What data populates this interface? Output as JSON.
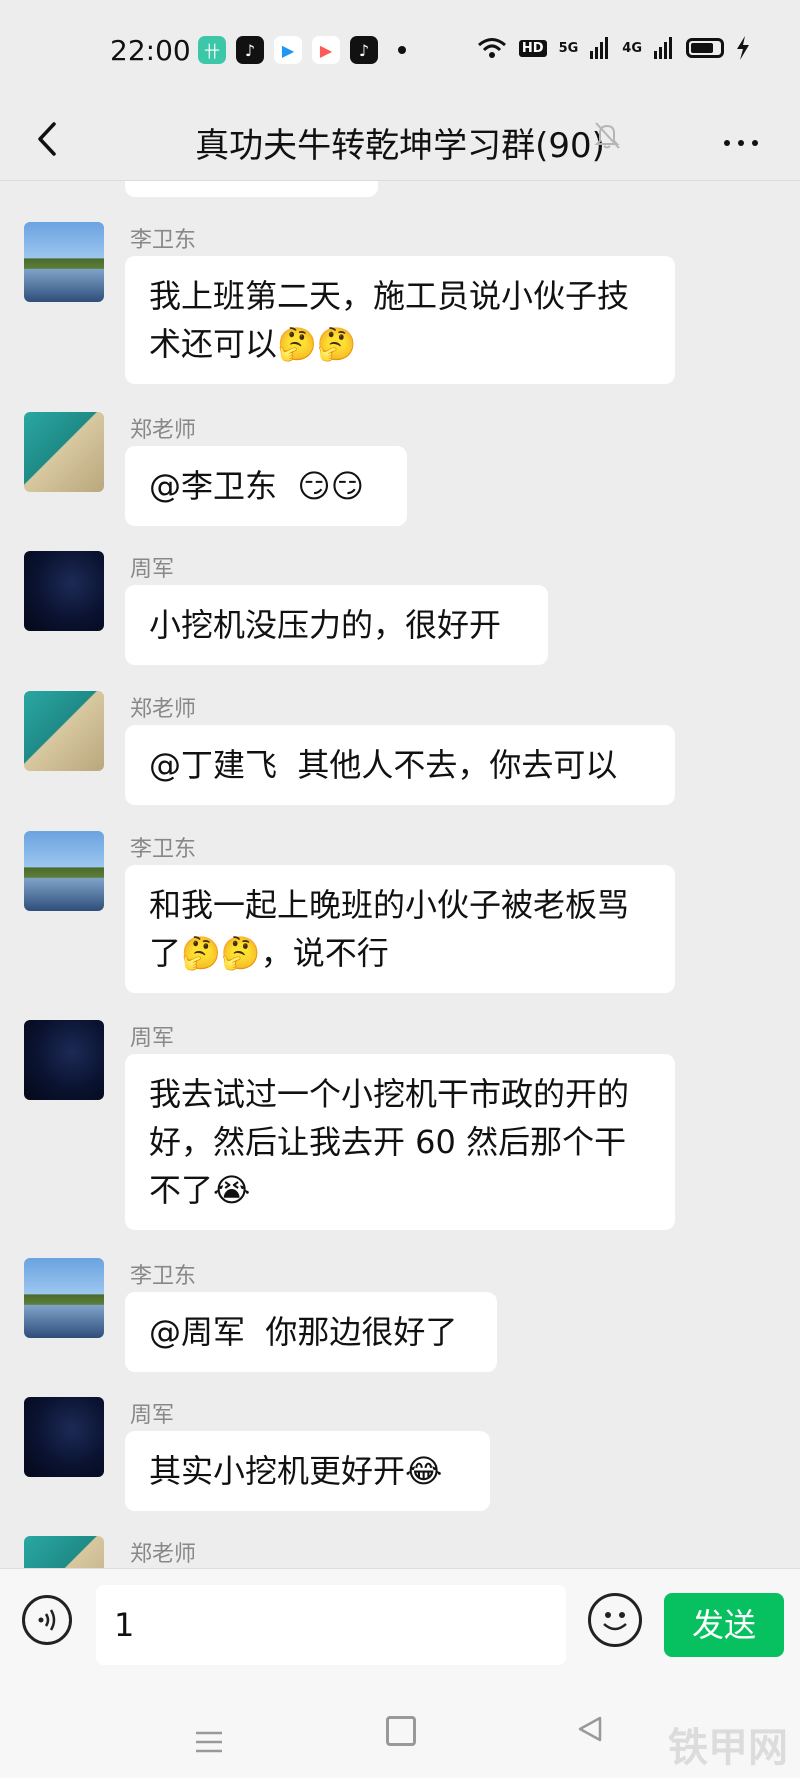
{
  "status_bar": {
    "time": "22:00",
    "app_icons": [
      "卄",
      "♪",
      "▶",
      "▶",
      "♪"
    ],
    "network_hd": "HD",
    "network_5g": "5G",
    "network_4g": "4G"
  },
  "header": {
    "title": "真功夫牛转乾坤学习群(90)",
    "back_icon": "chevron-left-icon",
    "mute_icon": "bell-off-icon",
    "more_icon": "more-icon"
  },
  "messages": [
    {
      "sender": "李卫东",
      "avatar": "lake",
      "text": "我上班第二天，施工员说小伙子技术还可以🤔🤔"
    },
    {
      "sender": "郑老师",
      "avatar": "forklift",
      "text": "@李卫东  😏😏"
    },
    {
      "sender": "周军",
      "avatar": "night",
      "text": "小挖机没压力的，很好开"
    },
    {
      "sender": "郑老师",
      "avatar": "forklift",
      "text": "@丁建飞  其他人不去，你去可以"
    },
    {
      "sender": "李卫东",
      "avatar": "lake",
      "text": "和我一起上晚班的小伙子被老板骂了🤔🤔，说不行"
    },
    {
      "sender": "周军",
      "avatar": "night",
      "text": "我去试过一个小挖机干市政的开的好，然后让我去开 60 然后那个干不了😭"
    },
    {
      "sender": "李卫东",
      "avatar": "lake",
      "text": "@周军  你那边很好了"
    },
    {
      "sender": "周军",
      "avatar": "night",
      "text": "其实小挖机更好开😂"
    },
    {
      "sender": "郑老师",
      "avatar": "forklift",
      "text": ""
    }
  ],
  "input_bar": {
    "value": "1",
    "send_label": "发送"
  },
  "watermark": "铁甲网"
}
